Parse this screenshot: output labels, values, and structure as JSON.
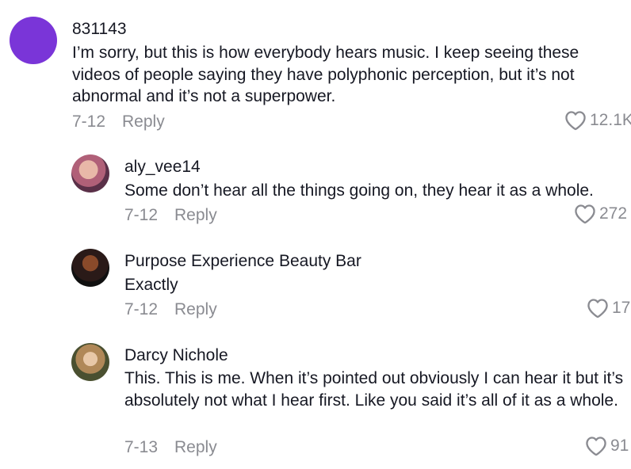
{
  "comments": [
    {
      "username": "831143",
      "text": "I’m sorry, but this is how everybody hears music. I keep seeing these videos of people saying they have polyphonic perception, but it’s not abnormal and it’s not a superpower.",
      "date": "7-12",
      "reply_label": "Reply",
      "likes": "12.1K",
      "avatar_color": "#7a35d8"
    }
  ],
  "replies": [
    {
      "username": "aly_vee14",
      "text": "Some don’t hear all the things going on, they hear it as a whole.",
      "date": "7-12",
      "reply_label": "Reply",
      "likes": "272"
    },
    {
      "username": "Purpose Experience Beauty Bar",
      "text": "Exactly",
      "date": "7-12",
      "reply_label": "Reply",
      "likes": "17"
    },
    {
      "username": "Darcy Nichole",
      "text": "This. This is me. When it’s pointed out obviously I can hear it but it’s absolutely not what I hear first. Like you said it’s all of it as a whole.",
      "date": "7-13",
      "reply_label": "Reply",
      "likes": "91"
    }
  ],
  "icons": {
    "like": "heart-outline-icon"
  },
  "colors": {
    "text": "#161823",
    "muted": "#8a8b91",
    "background": "#ffffff"
  }
}
